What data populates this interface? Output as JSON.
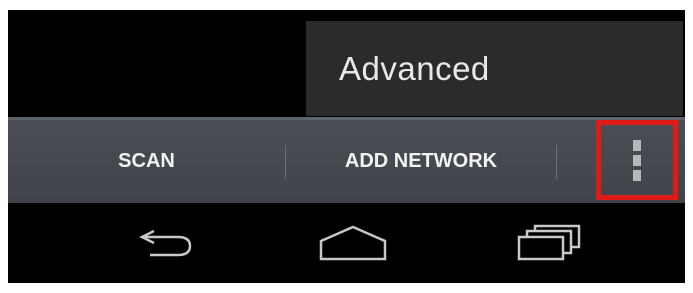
{
  "popup_menu": {
    "items": [
      {
        "label": "Advanced"
      }
    ]
  },
  "action_bar": {
    "scan_label": "SCAN",
    "add_network_label": "ADD NETWORK",
    "overflow_icon": "more-vertical-icon",
    "highlight_color": "#e01919"
  },
  "nav_bar": {
    "icons": [
      "back-icon",
      "home-icon",
      "recent-apps-icon"
    ]
  }
}
